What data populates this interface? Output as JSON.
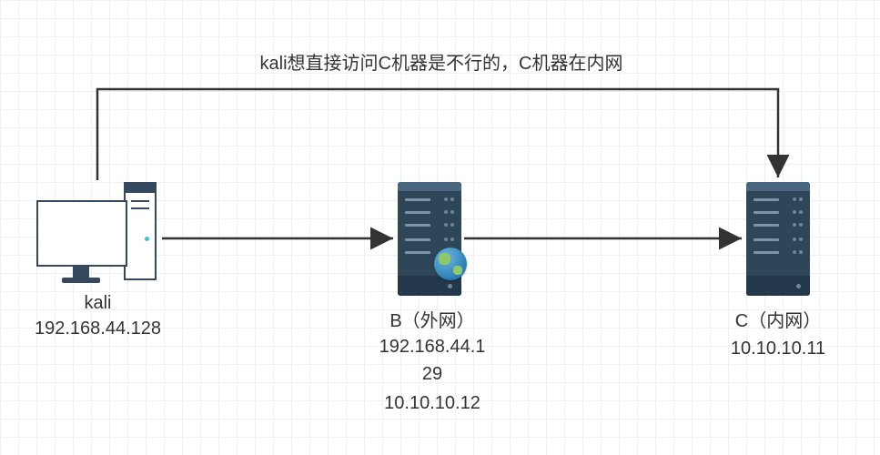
{
  "diagram": {
    "annotation": "kali想直接访问C机器是不行的，C机器在内网",
    "nodes": {
      "kali": {
        "name": "kali",
        "ip": "192.168.44.128"
      },
      "b": {
        "name": "B（外网）",
        "ip_external": "192.168.44.129",
        "ip_internal": "10.10.10.12"
      },
      "c": {
        "name": "C（内网）",
        "ip": "10.10.10.11"
      }
    },
    "edges": [
      {
        "from": "kali",
        "to": "b",
        "style": "solid-arrow"
      },
      {
        "from": "b",
        "to": "c",
        "style": "solid-arrow"
      },
      {
        "from": "kali",
        "to": "c",
        "style": "blocked-overhead-arrow",
        "note": "blocked"
      }
    ]
  },
  "chart_data": {
    "type": "diagram",
    "title": "kali想直接访问C机器是不行的，C机器在内网",
    "nodes": [
      {
        "id": "kali",
        "label": "kali",
        "ips": [
          "192.168.44.128"
        ],
        "role": "attacker-workstation"
      },
      {
        "id": "B",
        "label": "B（外网）",
        "ips": [
          "192.168.44.129",
          "10.10.10.12"
        ],
        "role": "dual-homed-server"
      },
      {
        "id": "C",
        "label": "C（内网）",
        "ips": [
          "10.10.10.11"
        ],
        "role": "internal-server"
      }
    ],
    "edges": [
      {
        "from": "kali",
        "to": "B",
        "reachable": true
      },
      {
        "from": "B",
        "to": "C",
        "reachable": true
      },
      {
        "from": "kali",
        "to": "C",
        "reachable": false,
        "note": "kali想直接访问C机器是不行的，C机器在内网"
      }
    ]
  }
}
